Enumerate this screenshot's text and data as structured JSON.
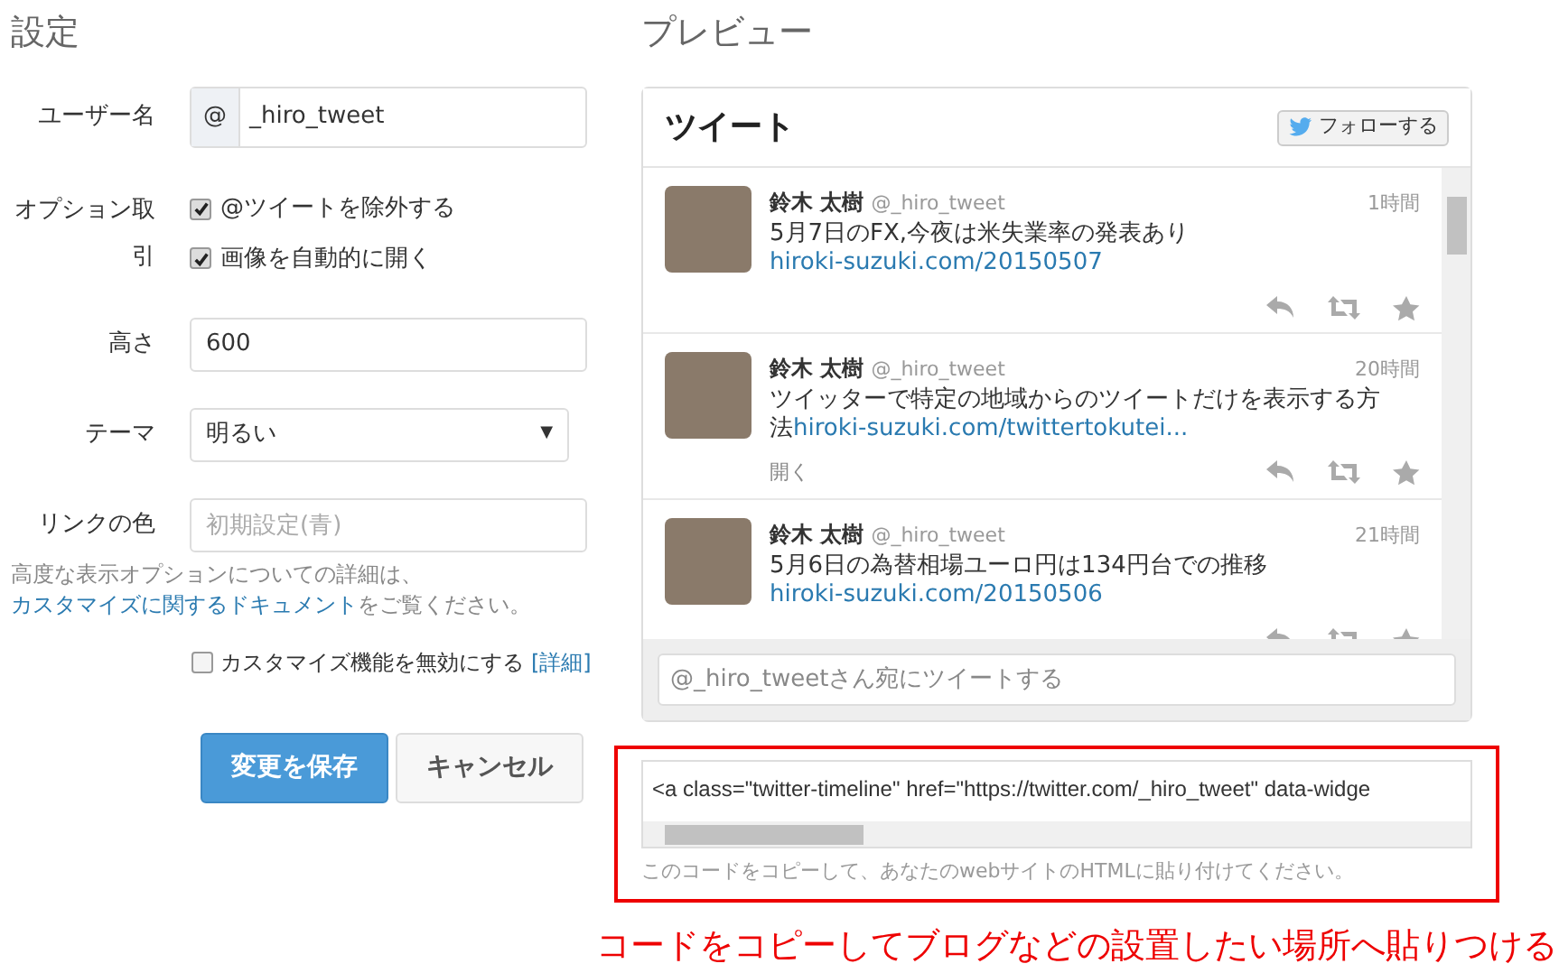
{
  "settings": {
    "title": "設定",
    "username": {
      "label": "ユーザー名",
      "prefix": "@",
      "value": "_hiro_tweet"
    },
    "options": {
      "label": "オプション取引",
      "items": [
        {
          "label": "@ツイートを除外する",
          "checked": true
        },
        {
          "label": "画像を自動的に開く",
          "checked": true
        }
      ]
    },
    "height": {
      "label": "高さ",
      "value": "600"
    },
    "theme": {
      "label": "テーマ",
      "value": "明るい",
      "caret": "▼"
    },
    "link_color": {
      "label": "リンクの色",
      "placeholder": "初期設定(青)"
    },
    "help": {
      "before": "高度な表示オプションについての詳細は、",
      "link": "カスタマイズに関するドキュメント",
      "after": "をご覧ください。"
    },
    "disable_custom": {
      "label": "カスタマイズ機能を無効にする",
      "checked": false,
      "link": "[詳細]"
    },
    "buttons": [
      {
        "label": "変更を保存",
        "kind": "primary"
      },
      {
        "label": "キャンセル",
        "kind": "default"
      }
    ]
  },
  "preview": {
    "title": "プレビュー",
    "widget": {
      "title": "ツイート",
      "follow": "フォローする",
      "tweets": [
        {
          "name": "鈴木 太樹",
          "handle": "@_hiro_tweet",
          "time": "1時間",
          "text": "5月7日のFX,今夜は米失業率の発表あり",
          "link": "hiroki-suzuki.com/20150507"
        },
        {
          "name": "鈴木 太樹",
          "handle": "@_hiro_tweet",
          "time": "20時間",
          "text": "ツイッターで特定の地域からのツイートだけを表示する方法",
          "link": "hiroki-suzuki.com/twittertokutei...",
          "expand": "開く"
        },
        {
          "name": "鈴木 太樹",
          "handle": "@_hiro_tweet",
          "time": "21時間",
          "text": "5月6日の為替相場ユーロ円は134円台での推移",
          "link": "hiroki-suzuki.com/20150506"
        }
      ],
      "reply_placeholder": "@_hiro_tweetさん宛にツイートする"
    },
    "code": "<a class=\"twitter-timeline\" href=\"https://twitter.com/_hiro_tweet\" data-widge",
    "code_hint": "このコードをコピーして、あなたのwebサイトのHTMLに貼り付けてください。"
  },
  "annotation": "コードをコピーしてブログなどの設置したい場所へ貼りつける"
}
